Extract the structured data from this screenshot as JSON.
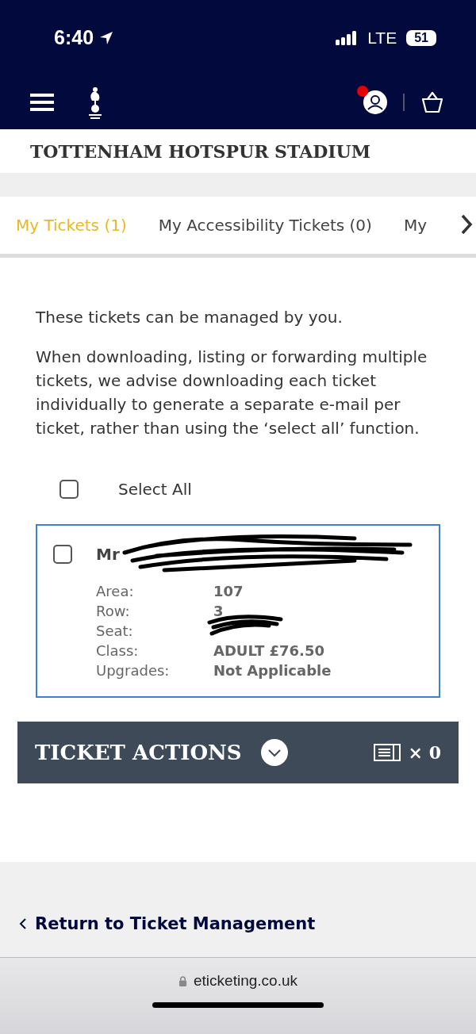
{
  "status_bar": {
    "time": "6:40",
    "network": "LTE",
    "battery": "51"
  },
  "header": {
    "notification": true
  },
  "venue_title": "TOTTENHAM HOTSPUR STADIUM",
  "tabs": [
    {
      "label": "My Tickets (1)",
      "selected": true
    },
    {
      "label": "My Accessibility Tickets (0)",
      "selected": false
    },
    {
      "label": "My",
      "selected": false
    }
  ],
  "intro": "These tickets can be managed by you.",
  "advice": "When downloading, listing or forwarding multiple tickets, we advise downloading each ticket individually to generate a separate e-mail per ticket, rather than using the ‘select all’ function.",
  "select_all": {
    "label": "Select All",
    "checked": false
  },
  "tickets": [
    {
      "holder": "Mr",
      "checked": false,
      "details": [
        {
          "label": "Area:",
          "value": "107"
        },
        {
          "label": "Row:",
          "value": "3"
        },
        {
          "label": "Seat:",
          "redacted": true
        },
        {
          "label": "Class:",
          "value": "ADULT £76.50"
        },
        {
          "label": "Upgrades:",
          "value": "Not Applicable"
        }
      ]
    }
  ],
  "ticket_actions": {
    "label": "TICKET ACTIONS",
    "count": "× 0"
  },
  "return_link": "Return to Ticket Management",
  "browser": {
    "url": "eticketing.co.uk"
  }
}
